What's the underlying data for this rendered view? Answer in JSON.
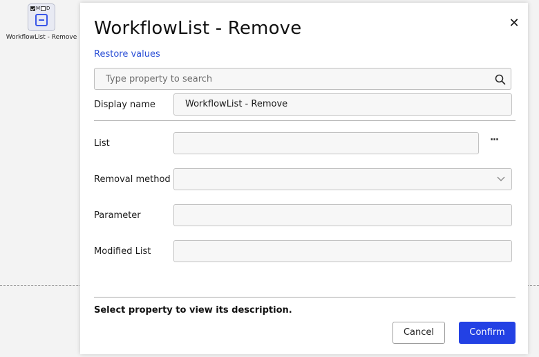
{
  "canvas": {
    "node": {
      "flags": [
        "M",
        "D"
      ],
      "label": "WorkflowList - Remove",
      "icon": "minus-square-icon"
    }
  },
  "dialog": {
    "title": "WorkflowList - Remove",
    "close_icon": "close-icon",
    "restore_label": "Restore values",
    "search": {
      "placeholder": "Type property to search",
      "value": "",
      "icon": "search-icon"
    },
    "display_name": {
      "label": "Display name",
      "value": "WorkflowList - Remove"
    },
    "properties": {
      "list": {
        "label": "List",
        "value": "",
        "more_icon": "ellipsis-icon",
        "more_label": "···"
      },
      "removal_method": {
        "label": "Removal method",
        "value": "",
        "icon": "chevron-down-icon"
      },
      "parameter": {
        "label": "Parameter",
        "value": ""
      },
      "modified_list": {
        "label": "Modified List",
        "value": ""
      }
    },
    "description_hint": "Select property to view its description.",
    "buttons": {
      "cancel": "Cancel",
      "confirm": "Confirm"
    }
  },
  "colors": {
    "accent": "#2341e4",
    "link": "#2b4fd6",
    "node_icon": "#3a57e8"
  }
}
